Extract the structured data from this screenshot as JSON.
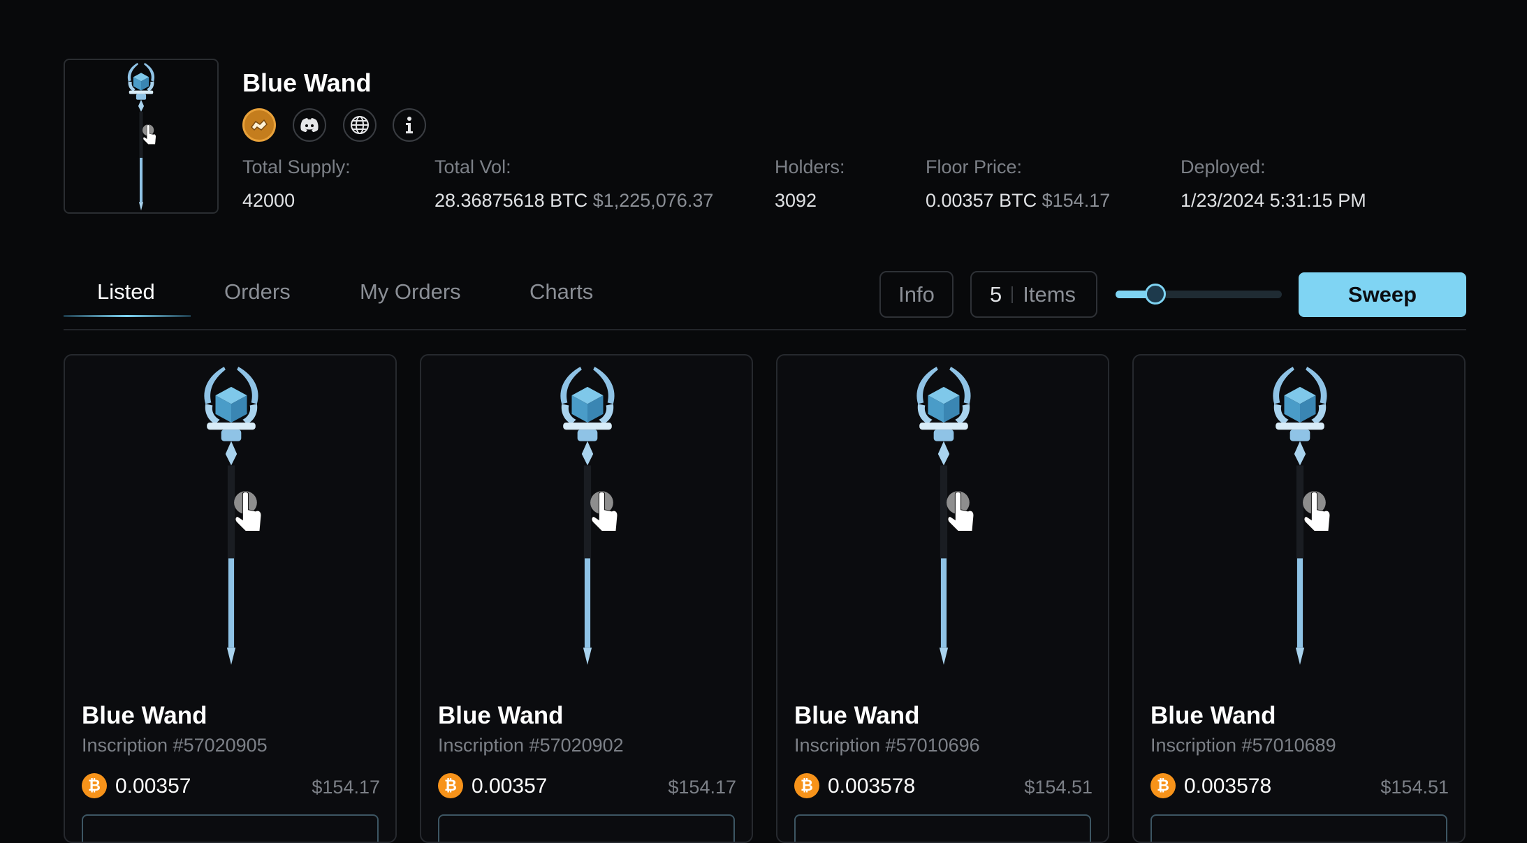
{
  "collection": {
    "name": "Blue Wand",
    "socials": [
      "magic-eden-icon",
      "discord-icon",
      "globe-icon",
      "info-icon"
    ],
    "stats": {
      "total_supply": {
        "label": "Total Supply:",
        "value": "42000"
      },
      "total_vol": {
        "label": "Total Vol:",
        "value": "28.36875618 BTC",
        "usd": "$1,225,076.37"
      },
      "holders": {
        "label": "Holders:",
        "value": "3092"
      },
      "floor_price": {
        "label": "Floor Price:",
        "value": "0.00357 BTC",
        "usd": "$154.17"
      },
      "deployed": {
        "label": "Deployed:",
        "value": "1/23/2024 5:31:15 PM"
      }
    }
  },
  "tabs": [
    {
      "label": "Listed",
      "active": true
    },
    {
      "label": "Orders",
      "active": false
    },
    {
      "label": "My Orders",
      "active": false
    },
    {
      "label": "Charts",
      "active": false
    }
  ],
  "toolbar": {
    "info_label": "Info",
    "items_count": "5",
    "items_label": "Items",
    "slider_fraction": 0.18,
    "sweep_label": "Sweep"
  },
  "colors": {
    "accent": "#7fd4f3",
    "background": "#08090b",
    "btc": "#f7931a"
  },
  "cards": [
    {
      "name": "Blue Wand",
      "inscription": "Inscription #57020905",
      "price": "0.00357",
      "usd": "$154.17"
    },
    {
      "name": "Blue Wand",
      "inscription": "Inscription #57020902",
      "price": "0.00357",
      "usd": "$154.17"
    },
    {
      "name": "Blue Wand",
      "inscription": "Inscription #57010696",
      "price": "0.003578",
      "usd": "$154.51"
    },
    {
      "name": "Blue Wand",
      "inscription": "Inscription #57010689",
      "price": "0.003578",
      "usd": "$154.51"
    }
  ]
}
